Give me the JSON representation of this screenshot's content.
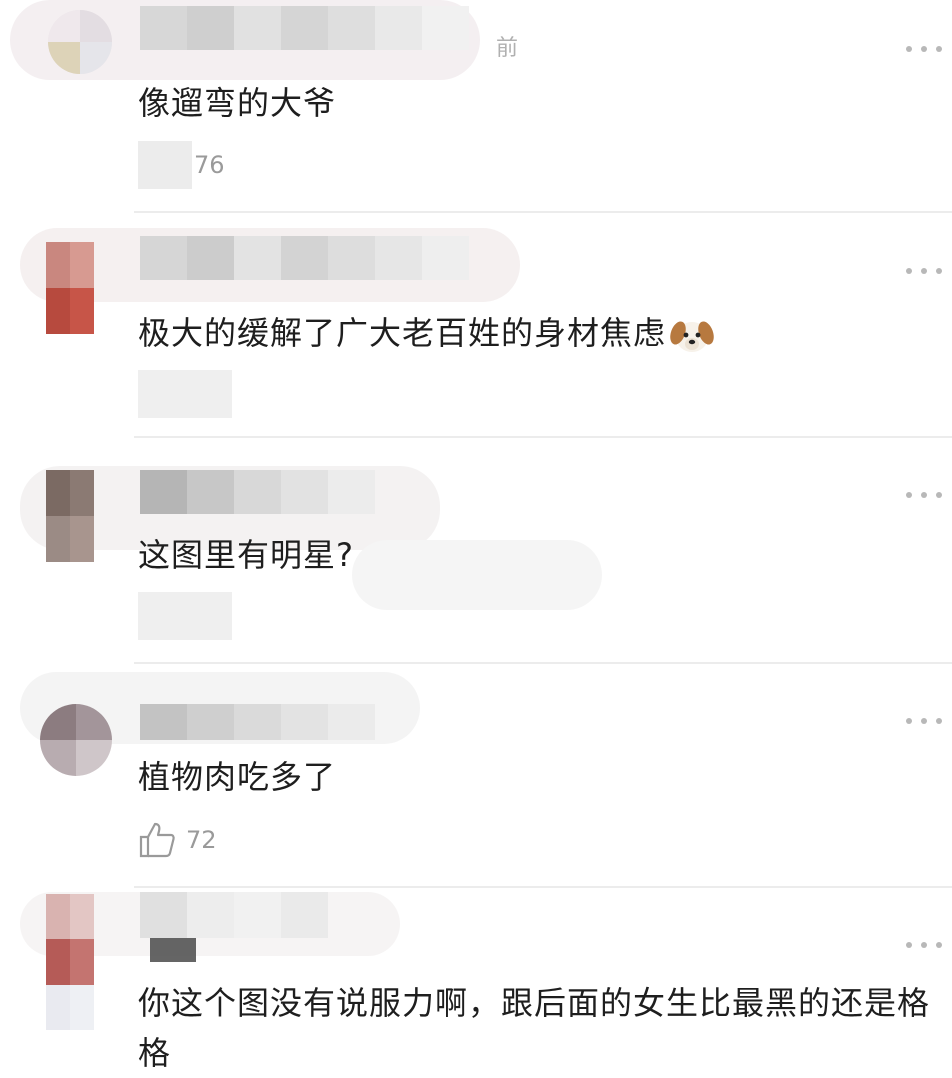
{
  "more_icon": "more-dots-icon",
  "like_icon": "thumbs-up-icon",
  "comments": [
    {
      "time": "前",
      "text": "像遛弯的大爷",
      "likes": "76"
    },
    {
      "time": "",
      "text": "极大的缓解了广大老百姓的身材焦虑",
      "emoji": "dog-face-icon",
      "likes": ""
    },
    {
      "time": "",
      "text": "这图里有明星?",
      "likes": ""
    },
    {
      "time": "",
      "text": "植物肉吃多了",
      "likes": "72"
    },
    {
      "time": "",
      "text": "你这个图没有说服力啊，跟后面的女生比最黑的还是格格",
      "likes": ""
    }
  ]
}
